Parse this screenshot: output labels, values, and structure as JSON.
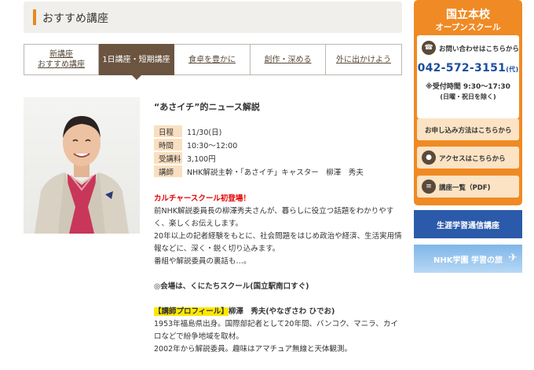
{
  "section": {
    "title": "おすすめ講座"
  },
  "tabs": [
    {
      "line1": "新講座",
      "line2": "おすすめ講座",
      "active": false
    },
    {
      "line1": "1日講座・短期講座",
      "line2": "",
      "active": true
    },
    {
      "line1": "食卓を豊かに",
      "line2": "",
      "active": false
    },
    {
      "line1": "創作・深める",
      "line2": "",
      "active": false
    },
    {
      "line1": "外に出かけよう",
      "line2": "",
      "active": false
    }
  ],
  "course": {
    "title": "“あさイチ”的ニュース解説",
    "info": [
      {
        "label": "日程",
        "value": "11/30(日)"
      },
      {
        "label": "時間",
        "value": "10:30～12:00"
      },
      {
        "label": "受講料",
        "value": "3,100円"
      },
      {
        "label": "講師",
        "value": "NHK解説主幹・「あさイチ」キャスター　柳澤　秀夫"
      }
    ],
    "headline": "カルチャースクール初登場！",
    "desc1": "前NHK解説委員長の柳澤秀夫さんが、暮らしに役立つ話題をわかりやすく、楽しくお伝えします。",
    "desc2": "20年以上の記者経験をもとに、社会問題をはじめ政治や経済、生活実用情報などに、深く・鋭く切り込みます。",
    "desc3": "番組や解説委員の裏話も…。",
    "venue": "◎会場は、くにたちスクール(国立駅南口すぐ)",
    "profile_tag": "【講師プロフィール】",
    "profile_name": "柳澤　秀夫(やなぎさわ ひでお)",
    "profile1": "1953年福島県出身。国際部記者として20年間、バンコク、マニラ、カイロなどで紛争地域を取材。",
    "profile2": "2002年から解説委員。趣味はアマチュア無線と天体観測。"
  },
  "sidebar": {
    "school": "国立本校",
    "subtitle": "オープンスクール",
    "contact_label": "お問い合わせはこちらから",
    "phone": "042-572-3151",
    "phone_suffix": "(代)",
    "hours": "※受付時間 9:30～17:30",
    "hours_note": "(日曜・祝日を除く)",
    "apply_label": "お申し込み方法はこちらから",
    "access_label": "アクセスはこちらから",
    "list_label": "講座一覧（PDF)",
    "banner1": "生涯学習通信講座",
    "banner2": "NHK学園 学習の旅"
  },
  "colors": {
    "accent": "#f08a24",
    "tab_active": "#6b5440",
    "label_bg": "#f9dfc0",
    "phone": "#1a4fa0",
    "headline": "#e60000"
  }
}
